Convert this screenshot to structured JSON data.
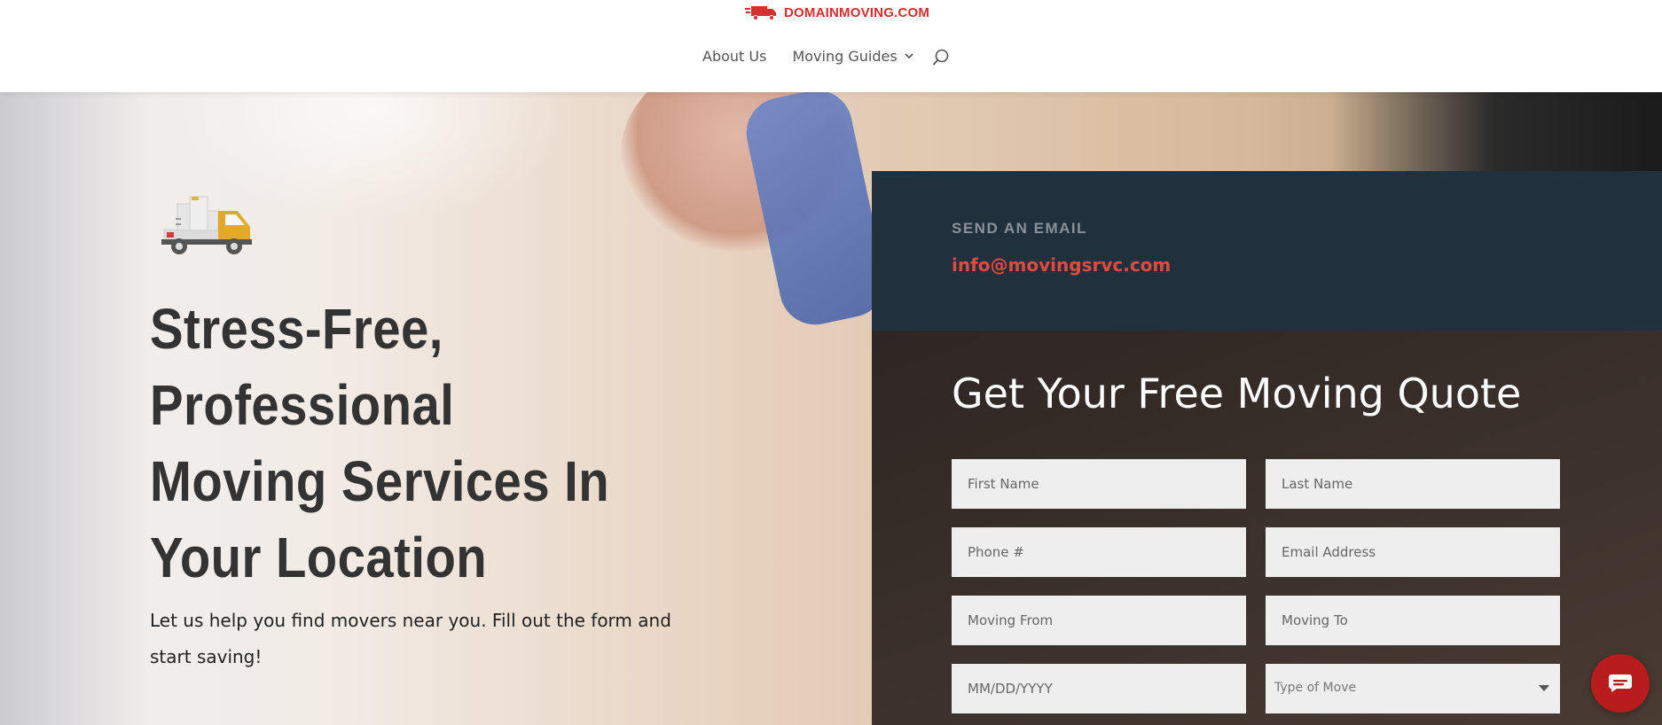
{
  "brand": {
    "name": "DOMAINMOVING.COM",
    "color": "#d32f2f"
  },
  "nav": {
    "items": [
      {
        "label": "About Us"
      },
      {
        "label": "Moving Guides"
      }
    ]
  },
  "hero": {
    "headline": "Stress-Free, Professional Moving Services In Your Location",
    "subtext": "Let us help you find movers near you. Fill out the form and start saving!"
  },
  "contact": {
    "label": "SEND AN EMAIL",
    "email": "info@movingsrvc.com"
  },
  "quote_form": {
    "title": "Get Your Free Moving Quote",
    "fields": {
      "first_name": {
        "placeholder": "First Name"
      },
      "last_name": {
        "placeholder": "Last Name"
      },
      "phone": {
        "placeholder": "Phone #"
      },
      "email": {
        "placeholder": "Email Address"
      },
      "moving_from": {
        "placeholder": "Moving From"
      },
      "moving_to": {
        "placeholder": "Moving To"
      },
      "move_date": {
        "placeholder": "MM/DD/YYYY"
      },
      "move_type": {
        "value": "Type of Move"
      }
    }
  },
  "icons": {
    "search": "search-icon",
    "chevron": "chevron-down-icon",
    "chat": "chat-icon",
    "truck": "truck-icon"
  },
  "colors": {
    "accent_red": "#e04a3f",
    "contact_bg": "#21303d",
    "chat_button": "#b91c1c"
  }
}
